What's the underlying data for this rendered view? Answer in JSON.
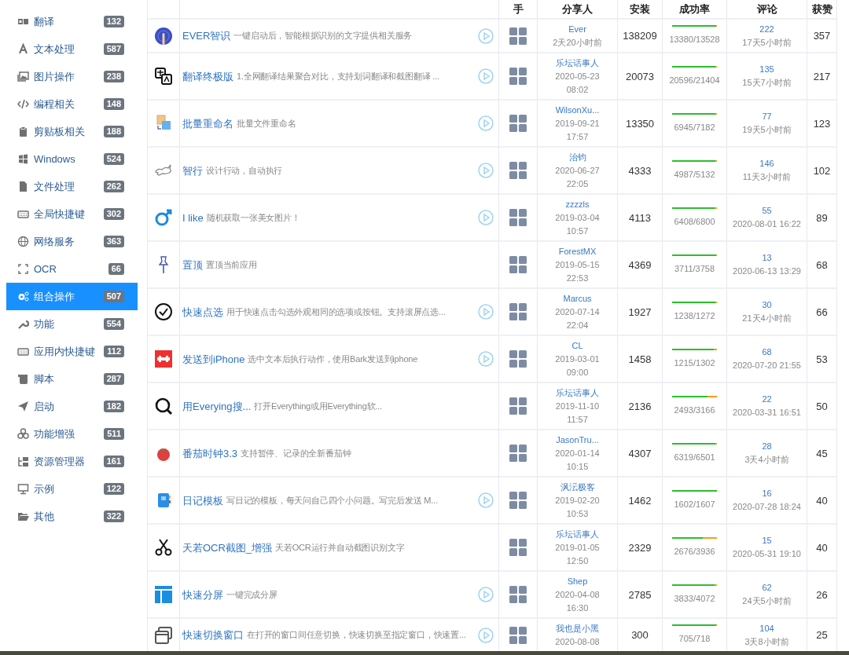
{
  "sidebar": {
    "items": [
      {
        "label": "翻译",
        "count": "132",
        "selected": false
      },
      {
        "label": "文本处理",
        "count": "587",
        "selected": false
      },
      {
        "label": "图片操作",
        "count": "238",
        "selected": false
      },
      {
        "label": "编程相关",
        "count": "148",
        "selected": false
      },
      {
        "label": "剪贴板相关",
        "count": "188",
        "selected": false
      },
      {
        "label": "Windows",
        "count": "524",
        "selected": false
      },
      {
        "label": "文件处理",
        "count": "262",
        "selected": false
      },
      {
        "label": "全局快捷键",
        "count": "302",
        "selected": false
      },
      {
        "label": "网络服务",
        "count": "363",
        "selected": false
      },
      {
        "label": "OCR",
        "count": "66",
        "selected": false
      },
      {
        "label": "组合操作",
        "count": "507",
        "selected": true
      },
      {
        "label": "功能",
        "count": "554",
        "selected": false
      },
      {
        "label": "应用内快捷键",
        "count": "112",
        "selected": false
      },
      {
        "label": "脚本",
        "count": "287",
        "selected": false
      },
      {
        "label": "启动",
        "count": "182",
        "selected": false
      },
      {
        "label": "功能增强",
        "count": "511",
        "selected": false
      },
      {
        "label": "资源管理器",
        "count": "161",
        "selected": false
      },
      {
        "label": "示例",
        "count": "122",
        "selected": false
      },
      {
        "label": "其他",
        "count": "322",
        "selected": false
      }
    ]
  },
  "table": {
    "columns": [
      "手",
      "分享人",
      "安装",
      "成功率",
      "评论",
      "获赞"
    ],
    "rows": [
      {
        "name": "EVER智识",
        "description": "一键启动后，智能根据识别的文字提供相关服务",
        "runnable": true,
        "owner": "Ever",
        "owner_lines": [
          "2天20小时前"
        ],
        "installs": "138209",
        "level": 0.989,
        "success": "13380/13528",
        "comments": "222",
        "comment_time": "17天5小时前",
        "likes": "357"
      },
      {
        "name": "翻译终极版",
        "description": "1.全网翻译结果聚合对比，支持划词翻译和截图翻译 ...",
        "runnable": true,
        "owner": "乐坛话事人",
        "owner_lines": [
          "2020-05-23",
          "08:02"
        ],
        "installs": "20073",
        "level": 0.962,
        "success": "20596/21404",
        "comments": "135",
        "comment_time": "15天7小时前",
        "likes": "217"
      },
      {
        "name": "批量重命名",
        "description": "批量文件重命名",
        "runnable": true,
        "owner": "WilsonXu...",
        "owner_lines": [
          "2019-09-21",
          "17:57"
        ],
        "installs": "13350",
        "level": 0.967,
        "success": "6945/7182",
        "comments": "77",
        "comment_time": "19天5小时前",
        "likes": "123"
      },
      {
        "name": "智行",
        "description": "设计行动，自动执行",
        "runnable": true,
        "owner": "治钧",
        "owner_lines": [
          "2020-06-27",
          "22:05"
        ],
        "installs": "4333",
        "level": 0.972,
        "success": "4987/5132",
        "comments": "146",
        "comment_time": "11天3小时前",
        "likes": "102"
      },
      {
        "name": "I like",
        "description": "随机获取一张美女图片！",
        "runnable": true,
        "owner": "zzzzls",
        "owner_lines": [
          "2019-03-04",
          "10:57"
        ],
        "installs": "4113",
        "level": 0.942,
        "success": "6408/6800",
        "comments": "55",
        "comment_time": "2020-08-01 16:22",
        "likes": "89"
      },
      {
        "name": "置顶",
        "description": "置顶当前应用",
        "runnable": false,
        "owner": "ForestMX",
        "owner_lines": [
          "2019-05-15",
          "22:53"
        ],
        "installs": "4369",
        "level": 0.987,
        "success": "3711/3758",
        "comments": "13",
        "comment_time": "2020-06-13 13:29",
        "likes": "68"
      },
      {
        "name": "快速点选",
        "description": "用于快速点击勾选外观相同的选项或按钮。支持滚屏点选...",
        "runnable": true,
        "owner": "Marcus",
        "owner_lines": [
          "2020-07-14",
          "22:04"
        ],
        "installs": "1927",
        "level": 0.973,
        "success": "1238/1272",
        "comments": "30",
        "comment_time": "21天4小时前",
        "likes": "66"
      },
      {
        "name": "发送到iPhone",
        "description": "选中文本后执行动作，使用Bark发送到iphone",
        "runnable": true,
        "owner": "CL",
        "owner_lines": [
          "2019-03-01",
          "09:00"
        ],
        "installs": "1458",
        "level": 0.933,
        "success": "1215/1302",
        "comments": "68",
        "comment_time": "2020-07-20 21:55",
        "likes": "53"
      },
      {
        "name": "用Everying搜...",
        "description": "打开Everything或用Everything软...",
        "runnable": false,
        "owner": "乐坛话事人",
        "owner_lines": [
          "2019-11-10",
          "11:57"
        ],
        "installs": "2136",
        "level": 0.787,
        "success": "2493/3166",
        "comments": "22",
        "comment_time": "2020-03-31 16:51",
        "likes": "50"
      },
      {
        "name": "番茄时钟3.3",
        "description": "支持暂停、记录的全新番茄钟",
        "runnable": false,
        "owner": "JasonTru...",
        "owner_lines": [
          "2020-01-14",
          "10:15"
        ],
        "installs": "4307",
        "level": 0.971,
        "success": "6319/6501",
        "comments": "28",
        "comment_time": "3天4小时前",
        "likes": "45"
      },
      {
        "name": "日记模板",
        "description": "写日记的模板，每天问自己四个小问题。写完后发送 M...",
        "runnable": true,
        "owner": "沨沄极客",
        "owner_lines": [
          "2019-02-20",
          "10:53"
        ],
        "installs": "1462",
        "level": 0.997,
        "success": "1602/1607",
        "comments": "16",
        "comment_time": "2020-07-28 18:24",
        "likes": "40"
      },
      {
        "name": "天若OCR截图_增强",
        "description": "天若OCR运行并自动截图识别文字",
        "runnable": false,
        "owner": "乐坛话事人",
        "owner_lines": [
          "2019-01-05",
          "12:50"
        ],
        "installs": "2329",
        "level": 0.68,
        "success": "2676/3936",
        "comments": "15",
        "comment_time": "2020-05-31 19:10",
        "likes": "40"
      },
      {
        "name": "快速分屏",
        "description": "一键完成分屏",
        "runnable": true,
        "owner": "Shep",
        "owner_lines": [
          "2020-04-08",
          "16:30"
        ],
        "installs": "2785",
        "level": 0.941,
        "success": "3833/4072",
        "comments": "62",
        "comment_time": "24天5小时前",
        "likes": "26"
      },
      {
        "name": "快速切换窗口",
        "description": "在打开的窗口间任意切换，快速切换至指定窗口，快速置...",
        "runnable": true,
        "owner": "我也是小黑",
        "owner_lines": [
          "2020-08-08"
        ],
        "installs": "300",
        "level": 0.982,
        "success": "705/718",
        "comments": "104",
        "comment_time": "3天8小时前",
        "likes": "25"
      }
    ]
  }
}
